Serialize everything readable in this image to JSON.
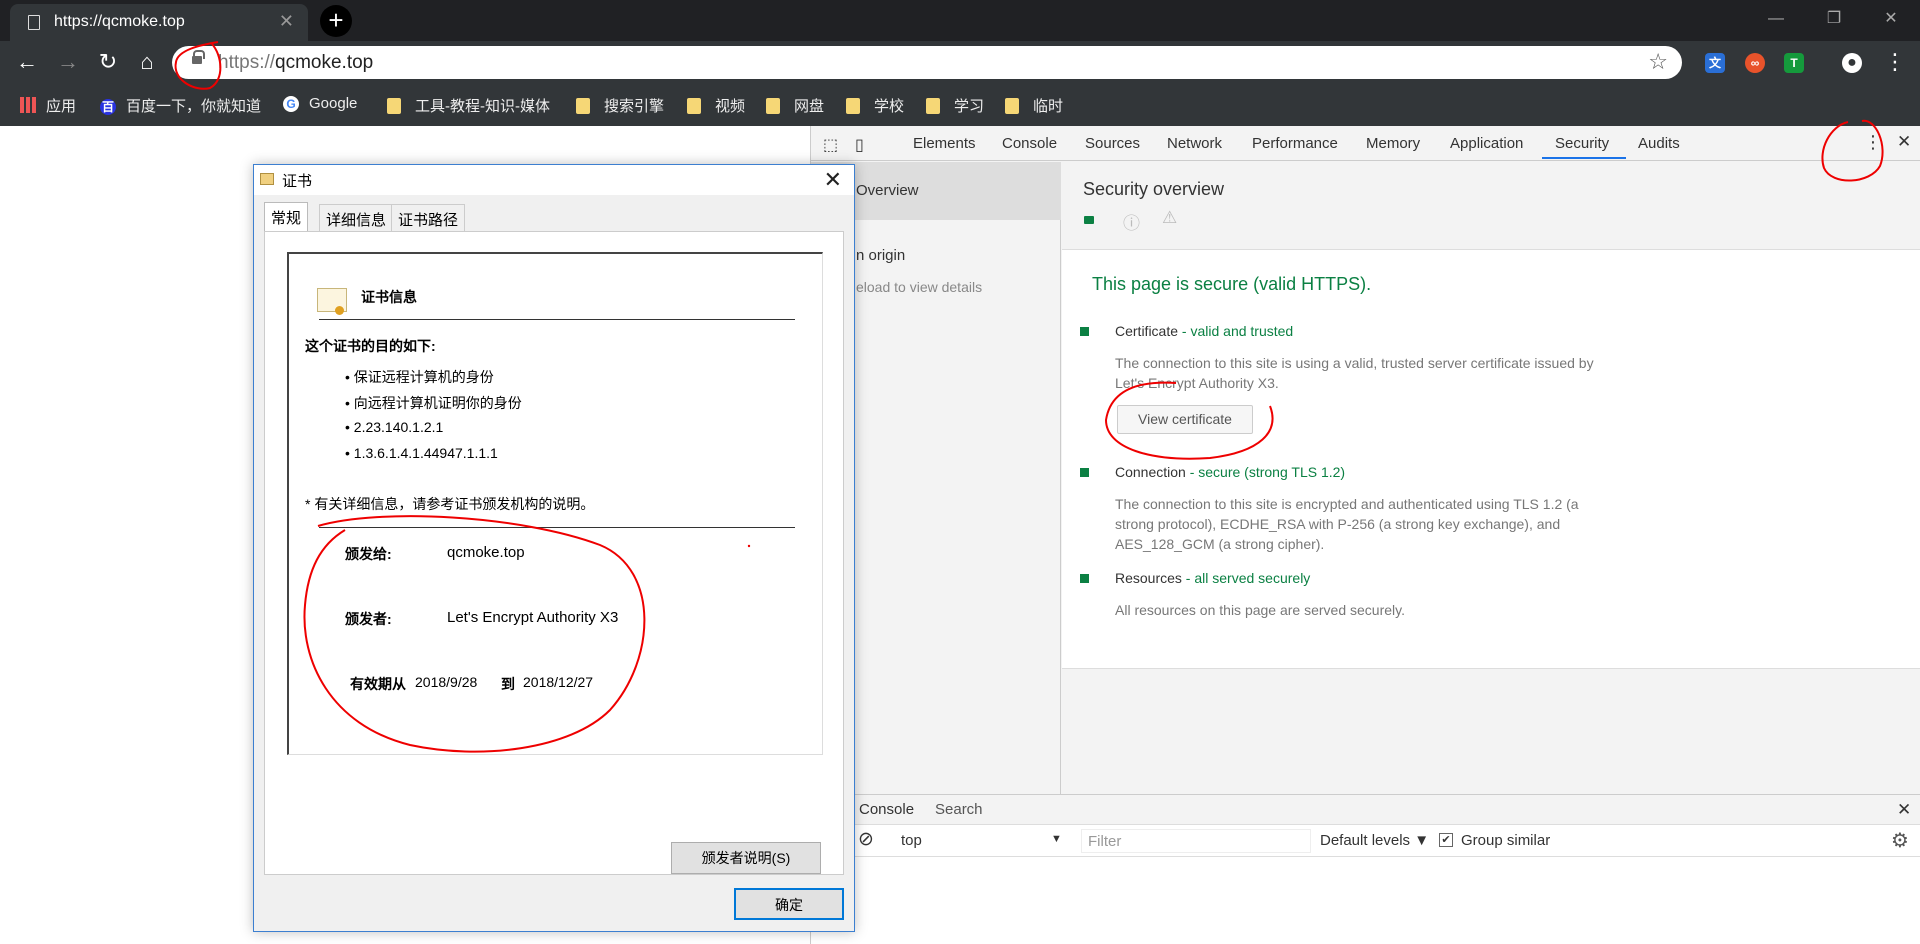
{
  "browser": {
    "tab_title": "https://qcmoke.top",
    "tab_close": "✕",
    "new_tab": "+",
    "url_scheme": "https://",
    "url_host": "qcmoke.top",
    "star": "☆",
    "win_minimize": "—",
    "win_restore": "❐",
    "win_close": "✕",
    "nav_back": "←",
    "nav_forward": "→",
    "nav_reload": "↻",
    "nav_home": "⌂",
    "menu": "⋮",
    "account": "●",
    "ext_icons": [
      "translate-icon",
      "infinity-icon",
      "tampermonkey-icon"
    ]
  },
  "bookmarks": [
    "应用",
    "百度一下，你就知道",
    "Google",
    "工具-教程-知识-媒体",
    "搜索引擎",
    "视频",
    "网盘",
    "学校",
    "学习",
    "临时"
  ],
  "devtools": {
    "tabs": [
      "Elements",
      "Console",
      "Sources",
      "Network",
      "Performance",
      "Memory",
      "Application",
      "Security",
      "Audits"
    ],
    "active_tab": "Security",
    "more": "⋮",
    "close": "✕",
    "sidebar": {
      "overview": "Overview",
      "origin": "n origin",
      "reload": "eload to view details"
    },
    "security": {
      "title": "Security overview",
      "icons": [
        "🔒",
        "ⓘ",
        "⚠"
      ],
      "headline": "This page is secure (valid HTTPS).",
      "cert_label": "Certificate",
      "cert_status": " - valid and trusted",
      "cert_desc": "The connection to this site is using a valid, trusted server certificate issued by Let's Encrypt Authority X3.",
      "view_cert": "View certificate",
      "conn_label": "Connection",
      "conn_status": " - secure (strong TLS 1.2)",
      "conn_desc": "The connection to this site is encrypted and authenticated using TLS 1.2 (a strong protocol), ECDHE_RSA with P-256 (a strong key exchange), and AES_128_GCM (a strong cipher).",
      "res_label": "Resources",
      "res_status": " - all served securely",
      "res_desc": "All resources on this page are served securely."
    },
    "drawer": {
      "tab_console": "Console",
      "tab_search": "Search",
      "close": "✕",
      "context": "top",
      "dropdown": "▼",
      "filter_placeholder": "Filter",
      "levels": "Default levels ▼",
      "group_similar": "Group similar",
      "checkbox": "✔",
      "gear": "⚙",
      "clear": "⊘"
    }
  },
  "dialog": {
    "title": "证书",
    "close": "✕",
    "tabs": [
      "常规",
      "详细信息",
      "证书路径"
    ],
    "heading": "证书信息",
    "purpose_title": "这个证书的目的如下:",
    "purposes": [
      "• 保证远程计算机的身份",
      "• 向远程计算机证明你的身份",
      "• 2.23.140.1.2.1",
      "• 1.3.6.1.4.1.44947.1.1.1"
    ],
    "note": "* 有关详细信息，请参考证书颁发机构的说明。",
    "issued_to_label": "颁发给:",
    "issued_to": "qcmoke.top",
    "issued_by_label": "颁发者:",
    "issued_by": "Let's Encrypt Authority X3",
    "valid_from_label": "有效期从",
    "valid_from": "2018/9/28",
    "valid_to_label": "到",
    "valid_to": "2018/12/27",
    "issuer_stmt_btn": "颁发者说明(S)",
    "ok_btn": "确定"
  },
  "colors": {
    "secure_green": "#0b8043",
    "annotation_red": "#e00000",
    "devtools_accent": "#1a73e8"
  }
}
